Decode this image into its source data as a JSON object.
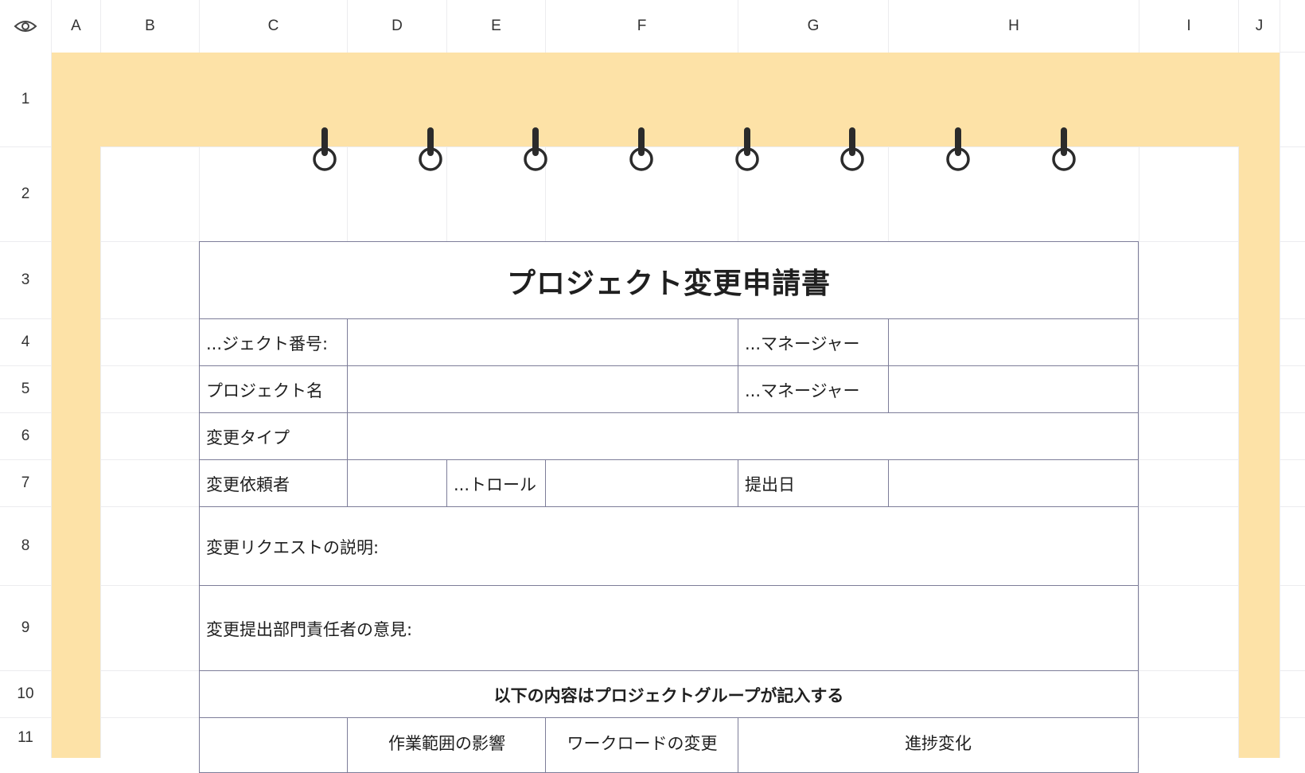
{
  "column_headers": [
    "A",
    "B",
    "C",
    "D",
    "E",
    "F",
    "G",
    "H",
    "I",
    "J"
  ],
  "row_headers": [
    "1",
    "2",
    "3",
    "4",
    "5",
    "6",
    "7",
    "8",
    "9",
    "10",
    "11"
  ],
  "icons": {
    "visibility": "eye-icon",
    "binder": "binder-ring-icon"
  },
  "colors": {
    "band": "#fde2a7",
    "border": "#7d7d99"
  },
  "form": {
    "title": "プロジェクト変更申請書",
    "project_number_label": "...ジェクト番号:",
    "manager_label_1": "...マネージャー",
    "project_name_label": "プロジェクト名",
    "manager_label_2": "...マネージャー",
    "change_type_label": "変更タイプ",
    "requester_label": "変更依頼者",
    "control_label": "...トロール",
    "submit_date_label": "提出日",
    "description_label": "変更リクエストの説明:",
    "opinion_label": "変更提出部門責任者の意見:",
    "section_label": "以下の内容はプロジェクトグループが記入する",
    "scope_label": "作業範囲の影響",
    "workload_label": "ワークロードの変更",
    "progress_label": "進捗変化"
  }
}
